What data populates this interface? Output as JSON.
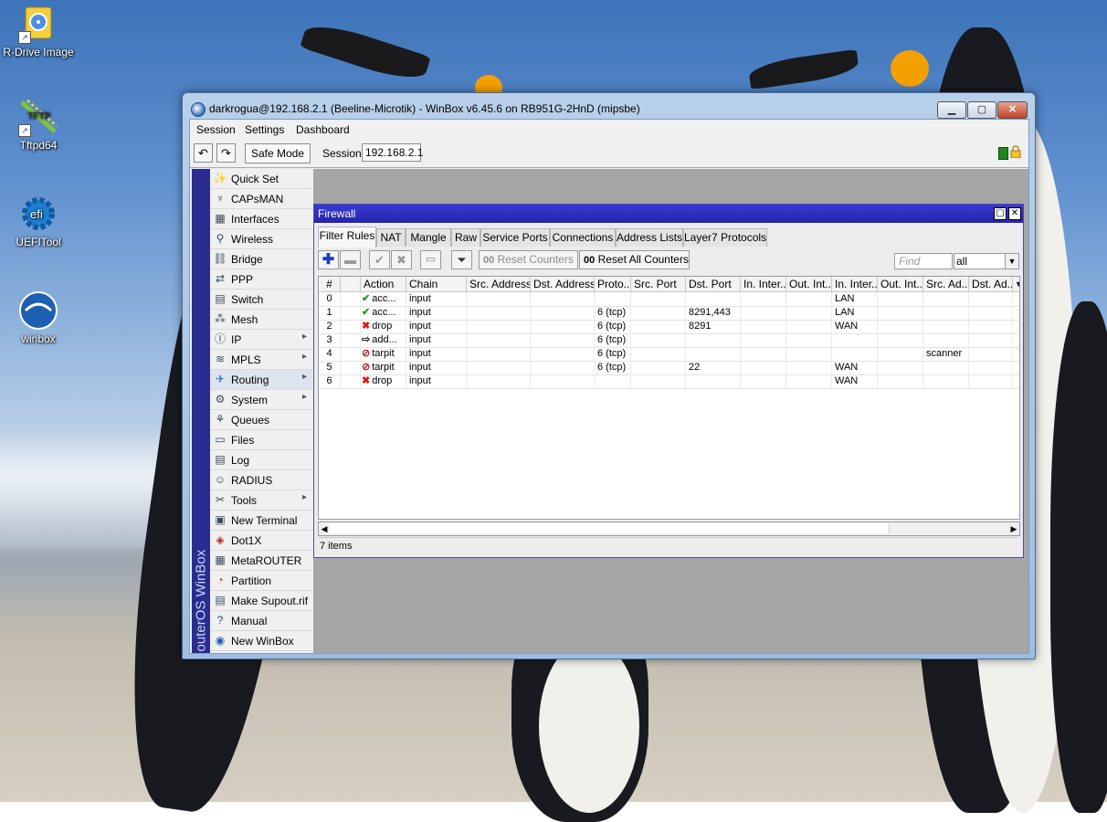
{
  "desktop": {
    "icons": [
      {
        "label": "R-Drive Image",
        "name": "r-drive-image-icon"
      },
      {
        "label": "Tftpd64",
        "name": "tftpd64-icon"
      },
      {
        "label": "UEFITool",
        "name": "ueftool-icon"
      },
      {
        "label": "winbox",
        "name": "winbox-icon"
      }
    ]
  },
  "window": {
    "title": "darkrogua@192.168.2.1 (Beeline-Microtik) - WinBox v6.45.6 on RB951G-2HnD (mipsbe)",
    "menu": [
      "Session",
      "Settings",
      "Dashboard"
    ],
    "toolbar": {
      "safe_mode": "Safe Mode",
      "session_label": "Session:",
      "session_value": "192.168.2.1"
    },
    "brand_strip": "outerOS WinBox"
  },
  "sidebar": {
    "items": [
      {
        "label": "Quick Set",
        "icon": "wand-icon",
        "submenu": false
      },
      {
        "label": "CAPsMAN",
        "icon": "antenna-icon",
        "submenu": false
      },
      {
        "label": "Interfaces",
        "icon": "interfaces-icon",
        "submenu": false
      },
      {
        "label": "Wireless",
        "icon": "wireless-icon",
        "submenu": false
      },
      {
        "label": "Bridge",
        "icon": "bridge-icon",
        "submenu": false
      },
      {
        "label": "PPP",
        "icon": "ppp-icon",
        "submenu": false
      },
      {
        "label": "Switch",
        "icon": "switch-icon",
        "submenu": false
      },
      {
        "label": "Mesh",
        "icon": "mesh-icon",
        "submenu": false
      },
      {
        "label": "IP",
        "icon": "ip-icon",
        "submenu": true
      },
      {
        "label": "MPLS",
        "icon": "mpls-icon",
        "submenu": true
      },
      {
        "label": "Routing",
        "icon": "routing-icon",
        "submenu": true
      },
      {
        "label": "System",
        "icon": "gear-icon",
        "submenu": true
      },
      {
        "label": "Queues",
        "icon": "queues-icon",
        "submenu": false
      },
      {
        "label": "Files",
        "icon": "folder-icon",
        "submenu": false
      },
      {
        "label": "Log",
        "icon": "log-icon",
        "submenu": false
      },
      {
        "label": "RADIUS",
        "icon": "radius-icon",
        "submenu": false
      },
      {
        "label": "Tools",
        "icon": "tools-icon",
        "submenu": true
      },
      {
        "label": "New Terminal",
        "icon": "terminal-icon",
        "submenu": false
      },
      {
        "label": "Dot1X",
        "icon": "dot1x-icon",
        "submenu": false
      },
      {
        "label": "MetaROUTER",
        "icon": "metarouter-icon",
        "submenu": false
      },
      {
        "label": "Partition",
        "icon": "partition-icon",
        "submenu": false
      },
      {
        "label": "Make Supout.rif",
        "icon": "supout-icon",
        "submenu": false
      },
      {
        "label": "Manual",
        "icon": "help-icon",
        "submenu": false
      },
      {
        "label": "New WinBox",
        "icon": "winbox-globe-icon",
        "submenu": false
      }
    ]
  },
  "firewall": {
    "title": "Firewall",
    "tabs": [
      "Filter Rules",
      "NAT",
      "Mangle",
      "Raw",
      "Service Ports",
      "Connections",
      "Address Lists",
      "Layer7 Protocols"
    ],
    "active_tab": "Filter Rules",
    "reset_counters": "Reset Counters",
    "reset_all_counters": "Reset All Counters",
    "counter_glyph": "00",
    "find_placeholder": "Find",
    "filter_value": "all",
    "columns": [
      "#",
      "",
      "Action",
      "Chain",
      "Src. Address",
      "Dst. Address",
      "Proto...",
      "Src. Port",
      "Dst. Port",
      "In. Inter...",
      "Out. Int...",
      "In. Inter...",
      "Out. Int...",
      "Src. Ad...",
      "Dst. Ad..."
    ],
    "rows": [
      {
        "num": "0",
        "action": "acc...",
        "icon": "accept",
        "chain": "input",
        "proto": "",
        "dst_port": "",
        "in_iface_list": "LAN",
        "src_addr_list": ""
      },
      {
        "num": "1",
        "action": "acc...",
        "icon": "accept",
        "chain": "input",
        "proto": "6 (tcp)",
        "dst_port": "8291,443",
        "in_iface_list": "LAN",
        "src_addr_list": ""
      },
      {
        "num": "2",
        "action": "drop",
        "icon": "drop",
        "chain": "input",
        "proto": "6 (tcp)",
        "dst_port": "8291",
        "in_iface_list": "WAN",
        "src_addr_list": ""
      },
      {
        "num": "3",
        "action": "add...",
        "icon": "add",
        "chain": "input",
        "proto": "6 (tcp)",
        "dst_port": "",
        "in_iface_list": "",
        "src_addr_list": ""
      },
      {
        "num": "4",
        "action": "tarpit",
        "icon": "tarpit",
        "chain": "input",
        "proto": "6 (tcp)",
        "dst_port": "",
        "in_iface_list": "",
        "src_addr_list": "scanner"
      },
      {
        "num": "5",
        "action": "tarpit",
        "icon": "tarpit",
        "chain": "input",
        "proto": "6 (tcp)",
        "dst_port": "22",
        "in_iface_list": "WAN",
        "src_addr_list": ""
      },
      {
        "num": "6",
        "action": "drop",
        "icon": "drop",
        "chain": "input",
        "proto": "",
        "dst_port": "",
        "in_iface_list": "WAN",
        "src_addr_list": ""
      }
    ],
    "status": "7 items"
  }
}
